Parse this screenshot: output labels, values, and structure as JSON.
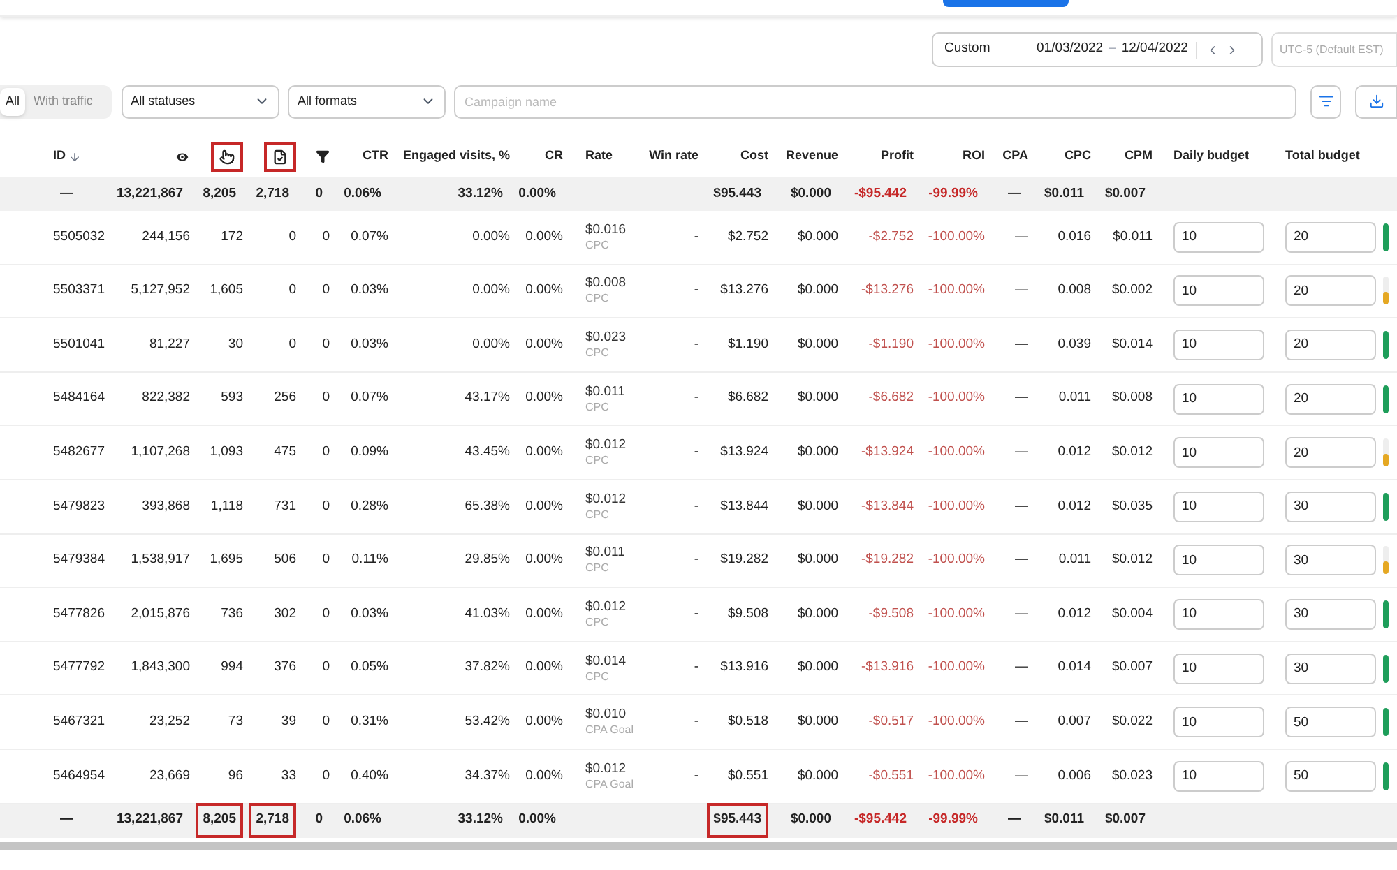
{
  "date_range": {
    "preset": "Custom",
    "start": "01/03/2022",
    "separator": "–",
    "end": "12/04/2022"
  },
  "timezone": {
    "label": "UTC-5 (Default EST)",
    "disabled": true
  },
  "traffic_toggle": [
    {
      "label": "All",
      "selected": true
    },
    {
      "label": "With traffic",
      "selected": false
    }
  ],
  "filters": {
    "status": "All statuses",
    "format": "All formats",
    "search_placeholder": "Campaign name"
  },
  "columns": [
    {
      "kind": "id",
      "label": "ID",
      "highlighted": false
    },
    {
      "kind": "eye",
      "highlighted": false
    },
    {
      "kind": "clicks",
      "highlighted": true
    },
    {
      "kind": "conversions",
      "highlighted": true
    },
    {
      "kind": "funnel",
      "highlighted": false
    },
    {
      "kind": "text",
      "label": "CTR",
      "highlighted": false
    },
    {
      "kind": "text",
      "label": "Engaged visits, %",
      "highlighted": false
    },
    {
      "kind": "text",
      "label": "CR",
      "highlighted": false
    },
    {
      "kind": "text",
      "label": "Rate",
      "highlighted": false
    },
    {
      "kind": "text",
      "label": "Win rate",
      "highlighted": false
    },
    {
      "kind": "text",
      "label": "Cost",
      "highlighted": false
    },
    {
      "kind": "text",
      "label": "Revenue",
      "highlighted": false
    },
    {
      "kind": "text",
      "label": "Profit",
      "highlighted": false
    },
    {
      "kind": "text",
      "label": "ROI",
      "highlighted": false
    },
    {
      "kind": "text",
      "label": "CPA",
      "highlighted": false
    },
    {
      "kind": "text",
      "label": "CPC",
      "highlighted": false
    },
    {
      "kind": "text",
      "label": "CPM",
      "highlighted": false
    },
    {
      "kind": "text",
      "label": "Daily budget",
      "highlighted": false
    },
    {
      "kind": "text",
      "label": "Total budget",
      "highlighted": false
    }
  ],
  "totals_top": {
    "id": {
      "text": "—",
      "highlighted": false
    },
    "impressions": {
      "text": "13,221,867",
      "highlighted": false
    },
    "clicks": {
      "text": "8,205",
      "highlighted": false
    },
    "conversions": {
      "text": "2,718",
      "highlighted": false
    },
    "funnel": {
      "text": "0",
      "highlighted": false
    },
    "ctr": {
      "text": "0.06%",
      "highlighted": false
    },
    "engaged": {
      "text": "33.12%",
      "highlighted": false
    },
    "cr": {
      "text": "0.00%",
      "highlighted": false
    },
    "cost": {
      "text": "$95.443",
      "highlighted": false
    },
    "revenue": {
      "text": "$0.000",
      "highlighted": false
    },
    "profit": {
      "text": "-$95.442",
      "highlighted": false
    },
    "roi": {
      "text": "-99.99%",
      "highlighted": false
    },
    "cpa": {
      "text": "—",
      "highlighted": false
    },
    "cpc": {
      "text": "$0.011",
      "highlighted": false
    },
    "cpm": {
      "text": "$0.007",
      "highlighted": false
    }
  },
  "rows": [
    {
      "id": "5505032",
      "impressions": "244,156",
      "clicks": "172",
      "conversions": "0",
      "funnel": "0",
      "ctr": "0.07%",
      "engaged": "0.00%",
      "cr": "0.00%",
      "rate": "$0.016",
      "rate_type": "CPC",
      "win_rate": "-",
      "cost": "$2.752",
      "revenue": "$0.000",
      "profit": "-$2.752",
      "roi": "-100.00%",
      "cpa": "—",
      "cpc": "0.016",
      "cpm": "$0.011",
      "daily_budget": "10",
      "total_budget": "20",
      "level": 1
    },
    {
      "id": "5503371",
      "impressions": "5,127,952",
      "clicks": "1,605",
      "conversions": "0",
      "funnel": "0",
      "ctr": "0.03%",
      "engaged": "0.00%",
      "cr": "0.00%",
      "rate": "$0.008",
      "rate_type": "CPC",
      "win_rate": "-",
      "cost": "$13.276",
      "revenue": "$0.000",
      "profit": "-$13.276",
      "roi": "-100.00%",
      "cpa": "—",
      "cpc": "0.008",
      "cpm": "$0.002",
      "daily_budget": "10",
      "total_budget": "20",
      "level": 0.45
    },
    {
      "id": "5501041",
      "impressions": "81,227",
      "clicks": "30",
      "conversions": "0",
      "funnel": "0",
      "ctr": "0.03%",
      "engaged": "0.00%",
      "cr": "0.00%",
      "rate": "$0.023",
      "rate_type": "CPC",
      "win_rate": "-",
      "cost": "$1.190",
      "revenue": "$0.000",
      "profit": "-$1.190",
      "roi": "-100.00%",
      "cpa": "—",
      "cpc": "0.039",
      "cpm": "$0.014",
      "daily_budget": "10",
      "total_budget": "20",
      "level": 1
    },
    {
      "id": "5484164",
      "impressions": "822,382",
      "clicks": "593",
      "conversions": "256",
      "funnel": "0",
      "ctr": "0.07%",
      "engaged": "43.17%",
      "cr": "0.00%",
      "rate": "$0.011",
      "rate_type": "CPC",
      "win_rate": "-",
      "cost": "$6.682",
      "revenue": "$0.000",
      "profit": "-$6.682",
      "roi": "-100.00%",
      "cpa": "—",
      "cpc": "0.011",
      "cpm": "$0.008",
      "daily_budget": "10",
      "total_budget": "20",
      "level": 1
    },
    {
      "id": "5482677",
      "impressions": "1,107,268",
      "clicks": "1,093",
      "conversions": "475",
      "funnel": "0",
      "ctr": "0.09%",
      "engaged": "43.45%",
      "cr": "0.00%",
      "rate": "$0.012",
      "rate_type": "CPC",
      "win_rate": "-",
      "cost": "$13.924",
      "revenue": "$0.000",
      "profit": "-$13.924",
      "roi": "-100.00%",
      "cpa": "—",
      "cpc": "0.012",
      "cpm": "$0.012",
      "daily_budget": "10",
      "total_budget": "20",
      "level": 0.45
    },
    {
      "id": "5479823",
      "impressions": "393,868",
      "clicks": "1,118",
      "conversions": "731",
      "funnel": "0",
      "ctr": "0.28%",
      "engaged": "65.38%",
      "cr": "0.00%",
      "rate": "$0.012",
      "rate_type": "CPC",
      "win_rate": "-",
      "cost": "$13.844",
      "revenue": "$0.000",
      "profit": "-$13.844",
      "roi": "-100.00%",
      "cpa": "—",
      "cpc": "0.012",
      "cpm": "$0.035",
      "daily_budget": "10",
      "total_budget": "30",
      "level": 1
    },
    {
      "id": "5479384",
      "impressions": "1,538,917",
      "clicks": "1,695",
      "conversions": "506",
      "funnel": "0",
      "ctr": "0.11%",
      "engaged": "29.85%",
      "cr": "0.00%",
      "rate": "$0.011",
      "rate_type": "CPC",
      "win_rate": "-",
      "cost": "$19.282",
      "revenue": "$0.000",
      "profit": "-$19.282",
      "roi": "-100.00%",
      "cpa": "—",
      "cpc": "0.011",
      "cpm": "$0.012",
      "daily_budget": "10",
      "total_budget": "30",
      "level": 0.45
    },
    {
      "id": "5477826",
      "impressions": "2,015,876",
      "clicks": "736",
      "conversions": "302",
      "funnel": "0",
      "ctr": "0.03%",
      "engaged": "41.03%",
      "cr": "0.00%",
      "rate": "$0.012",
      "rate_type": "CPC",
      "win_rate": "-",
      "cost": "$9.508",
      "revenue": "$0.000",
      "profit": "-$9.508",
      "roi": "-100.00%",
      "cpa": "—",
      "cpc": "0.012",
      "cpm": "$0.004",
      "daily_budget": "10",
      "total_budget": "30",
      "level": 1
    },
    {
      "id": "5477792",
      "impressions": "1,843,300",
      "clicks": "994",
      "conversions": "376",
      "funnel": "0",
      "ctr": "0.05%",
      "engaged": "37.82%",
      "cr": "0.00%",
      "rate": "$0.014",
      "rate_type": "CPC",
      "win_rate": "-",
      "cost": "$13.916",
      "revenue": "$0.000",
      "profit": "-$13.916",
      "roi": "-100.00%",
      "cpa": "—",
      "cpc": "0.014",
      "cpm": "$0.007",
      "daily_budget": "10",
      "total_budget": "30",
      "level": 1
    },
    {
      "id": "5467321",
      "impressions": "23,252",
      "clicks": "73",
      "conversions": "39",
      "funnel": "0",
      "ctr": "0.31%",
      "engaged": "53.42%",
      "cr": "0.00%",
      "rate": "$0.010",
      "rate_type": "CPA Goal",
      "win_rate": "-",
      "cost": "$0.518",
      "revenue": "$0.000",
      "profit": "-$0.517",
      "roi": "-100.00%",
      "cpa": "—",
      "cpc": "0.007",
      "cpm": "$0.022",
      "daily_budget": "10",
      "total_budget": "50",
      "level": 1
    },
    {
      "id": "5464954",
      "impressions": "23,669",
      "clicks": "96",
      "conversions": "33",
      "funnel": "0",
      "ctr": "0.40%",
      "engaged": "34.37%",
      "cr": "0.00%",
      "rate": "$0.012",
      "rate_type": "CPA Goal",
      "win_rate": "-",
      "cost": "$0.551",
      "revenue": "$0.000",
      "profit": "-$0.551",
      "roi": "-100.00%",
      "cpa": "—",
      "cpc": "0.006",
      "cpm": "$0.023",
      "daily_budget": "10",
      "total_budget": "50",
      "level": 1
    }
  ],
  "totals_bottom": {
    "id": {
      "text": "—",
      "highlighted": false
    },
    "impressions": {
      "text": "13,221,867",
      "highlighted": false
    },
    "clicks": {
      "text": "8,205",
      "highlighted": true
    },
    "conversions": {
      "text": "2,718",
      "highlighted": true
    },
    "funnel": {
      "text": "0",
      "highlighted": false
    },
    "ctr": {
      "text": "0.06%",
      "highlighted": false
    },
    "engaged": {
      "text": "33.12%",
      "highlighted": false
    },
    "cr": {
      "text": "0.00%",
      "highlighted": false
    },
    "cost": {
      "text": "$95.443",
      "highlighted": true
    },
    "revenue": {
      "text": "$0.000",
      "highlighted": false
    },
    "profit": {
      "text": "-$95.442",
      "highlighted": false
    },
    "roi": {
      "text": "-99.99%",
      "highlighted": false
    },
    "cpa": {
      "text": "—",
      "highlighted": false
    },
    "cpc": {
      "text": "$0.011",
      "highlighted": false
    },
    "cpm": {
      "text": "$0.007",
      "highlighted": false
    }
  }
}
